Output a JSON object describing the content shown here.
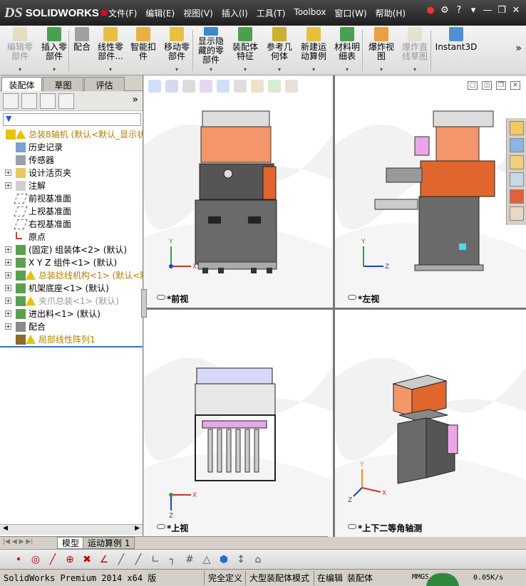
{
  "app": {
    "logo_prefix": "DS",
    "logo_text": "SOLIDWORKS"
  },
  "menu": [
    "文件(F)",
    "编辑(E)",
    "视图(V)",
    "插入(I)",
    "工具(T)",
    "Toolbox",
    "窗口(W)",
    "帮助(H)"
  ],
  "ribbon": {
    "buttons": [
      {
        "label": "编辑零\n部件",
        "disabled": true
      },
      {
        "label": "插入零\n部件",
        "disabled": false
      },
      {
        "label": "配合",
        "disabled": false
      },
      {
        "label": "线性零\n部件...",
        "disabled": false
      },
      {
        "label": "智能扣\n件",
        "disabled": false
      },
      {
        "label": "移动零\n部件",
        "disabled": false
      },
      {
        "label": "显示隐\n藏的零\n部件",
        "disabled": false
      },
      {
        "label": "装配体\n特征",
        "disabled": false
      },
      {
        "label": "参考几\n何体",
        "disabled": false
      },
      {
        "label": "新建运\n动算例",
        "disabled": false
      },
      {
        "label": "材料明\n细表",
        "disabled": false
      },
      {
        "label": "爆炸视\n图",
        "disabled": false
      },
      {
        "label": "爆炸直\n线草图",
        "disabled": true
      },
      {
        "label": "Instant3D",
        "disabled": false
      }
    ]
  },
  "left_tabs": [
    "装配体",
    "草图",
    "评估"
  ],
  "tree": [
    {
      "label": "总装8轴机    (默认<默认_显示状",
      "style": "warn",
      "pm": "",
      "icon": "asm-warn-icon",
      "indent": 0
    },
    {
      "label": "历史记录",
      "style": "",
      "pm": "",
      "icon": "history-icon",
      "indent": 1
    },
    {
      "label": "传感器",
      "style": "",
      "pm": "",
      "icon": "sensor-icon",
      "indent": 1
    },
    {
      "label": "设计活页夹",
      "style": "",
      "pm": "+",
      "icon": "binder-icon",
      "indent": 1
    },
    {
      "label": "注解",
      "style": "",
      "pm": "+",
      "icon": "annotation-icon",
      "indent": 1
    },
    {
      "label": "前视基准面",
      "style": "",
      "pm": "",
      "icon": "plane-icon",
      "indent": 1
    },
    {
      "label": "上视基准面",
      "style": "",
      "pm": "",
      "icon": "plane-icon",
      "indent": 1
    },
    {
      "label": "右视基准面",
      "style": "",
      "pm": "",
      "icon": "plane-icon",
      "indent": 1
    },
    {
      "label": "原点",
      "style": "",
      "pm": "",
      "icon": "origin-icon",
      "indent": 1
    },
    {
      "label": "(固定) 组装体<2> (默认)",
      "style": "",
      "pm": "+",
      "icon": "subasm-icon",
      "indent": 1
    },
    {
      "label": "X Y Z 组件<1> (默认)",
      "style": "",
      "pm": "+",
      "icon": "subasm-icon",
      "indent": 1
    },
    {
      "label": "总装捻线机构<1> (默认<默",
      "style": "warn",
      "pm": "+",
      "icon": "subasm-warn-icon",
      "indent": 1
    },
    {
      "label": "机架底座<1> (默认)",
      "style": "",
      "pm": "+",
      "icon": "subasm-icon",
      "indent": 1
    },
    {
      "label": "夹爪总装<1> (默认)",
      "style": "gray",
      "pm": "+",
      "icon": "subasm-warn-icon",
      "indent": 1
    },
    {
      "label": "进出料<1> (默认)",
      "style": "",
      "pm": "+",
      "icon": "subasm-icon",
      "indent": 1
    },
    {
      "label": "配合",
      "style": "",
      "pm": "+",
      "icon": "mates-icon",
      "indent": 1
    },
    {
      "label": "局部线性阵列1",
      "style": "warn",
      "pm": "",
      "icon": "pattern-icon",
      "indent": 1
    }
  ],
  "bottom_tabs": [
    "模型",
    "运动算例 1"
  ],
  "viewports": [
    {
      "caption": "*前视",
      "triad": "xy"
    },
    {
      "caption": "*左视",
      "triad": "zy"
    },
    {
      "caption": "*上视",
      "triad": "xz"
    },
    {
      "caption": "*上下二等角轴测",
      "triad": "iso"
    }
  ],
  "status": {
    "app": "SolidWorks Premium 2014 x64 版",
    "s1": "完全定义",
    "s2": "大型装配体模式",
    "s3": "在编辑",
    "s4": "装配体",
    "units": "MMGS",
    "net": "0.05K/s"
  },
  "colors": {
    "salmon": "#f4956a",
    "orange": "#e0662e",
    "dark": "#575757",
    "pink": "#e8a8e8",
    "accent": "#3a6ec8"
  }
}
